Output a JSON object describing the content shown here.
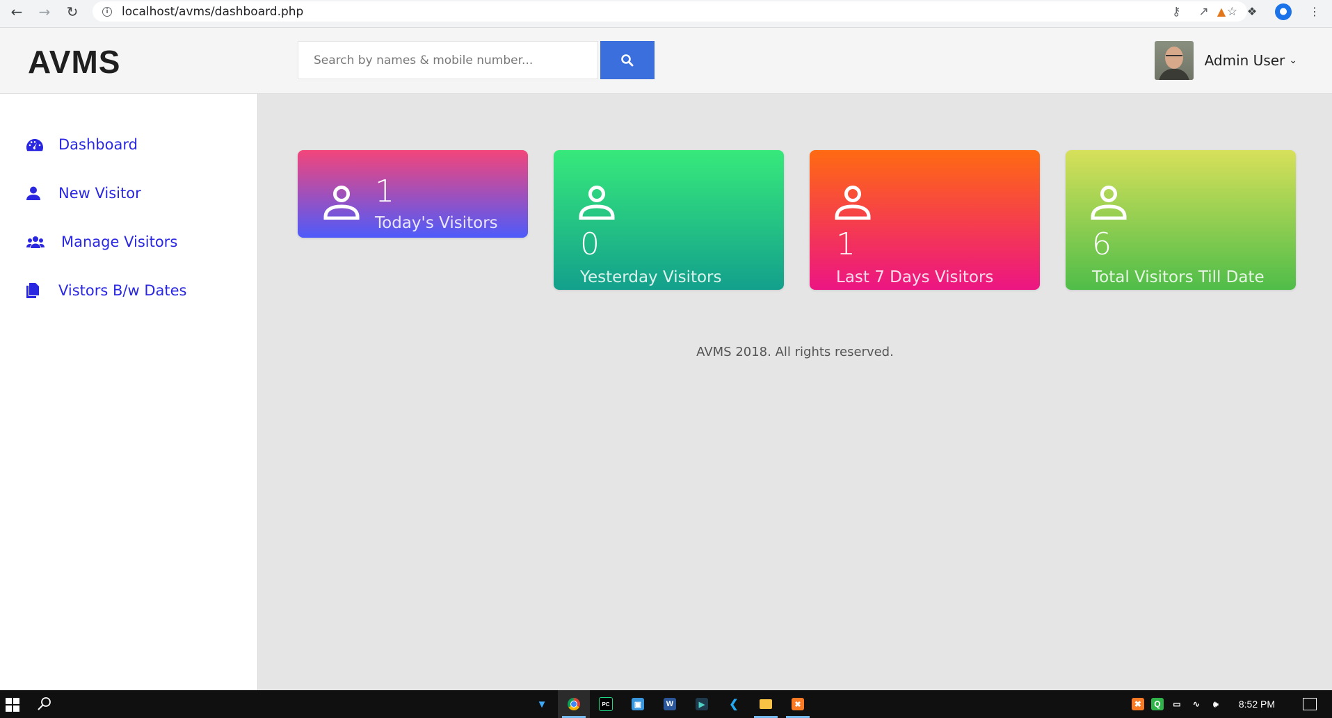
{
  "browser": {
    "url": "localhost/avms/dashboard.php"
  },
  "app": {
    "logo": "AVMS"
  },
  "sidebar": {
    "items": [
      {
        "label": "Dashboard",
        "icon": "dashboard-gauge-icon"
      },
      {
        "label": "New Visitor",
        "icon": "user-icon"
      },
      {
        "label": "Manage Visitors",
        "icon": "users-icon"
      },
      {
        "label": "Vistors B/w Dates",
        "icon": "documents-icon"
      }
    ]
  },
  "header": {
    "search_placeholder": "Search by names & mobile number...",
    "search_icon": "search-icon",
    "user_name": "Admin User"
  },
  "cards": [
    {
      "count": "1",
      "label": "Today's Visitors",
      "gradient": [
        "#f3457a",
        "#4e5bfa"
      ]
    },
    {
      "count": "0",
      "label": "Yesterday Visitors",
      "gradient": [
        "#37e97b",
        "#13a08c"
      ]
    },
    {
      "count": "1",
      "label": "Last 7 Days Visitors",
      "gradient": [
        "#ff6a12",
        "#ec1583"
      ]
    },
    {
      "count": "6",
      "label": "Total Visitors Till Date",
      "gradient": [
        "#d7e05a",
        "#4fbd49"
      ]
    }
  ],
  "footer": {
    "text": "AVMS 2018. All rights reserved."
  },
  "taskbar": {
    "time": "8:52 PM"
  },
  "colors": {
    "accent_blue": "#3b6fde",
    "menu_text": "#2a27e0",
    "content_bg": "#e5e5e5"
  }
}
